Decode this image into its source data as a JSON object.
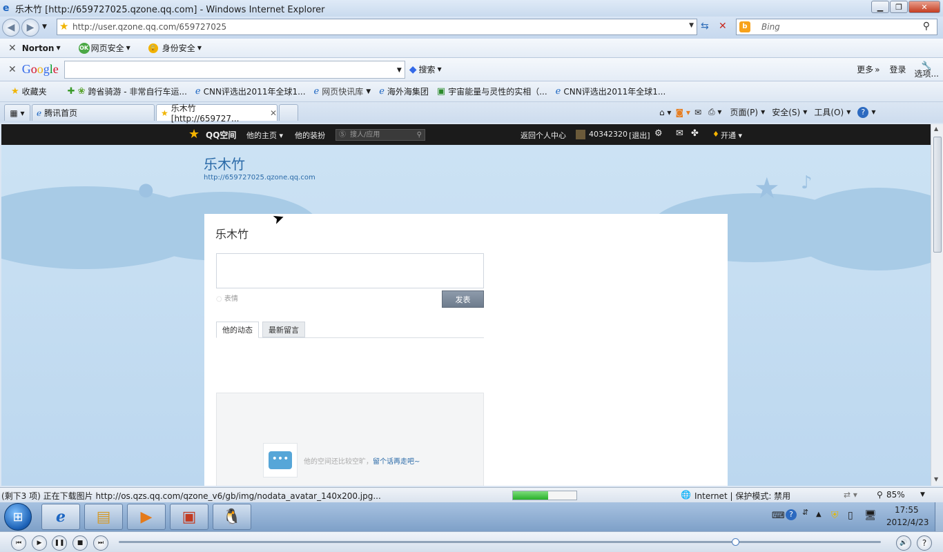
{
  "window": {
    "title": "乐木竹 [http://659727025.qzone.qq.com] - Windows Internet Explorer"
  },
  "address": {
    "url": "http://user.qzone.qq.com/659727025",
    "search_placeholder": "Bing"
  },
  "norton_bar": {
    "norton": "Norton",
    "web_security": "网页安全",
    "identity": "身份安全",
    "ok": "OK"
  },
  "google_bar": {
    "logo": "Google",
    "search_label": "搜索",
    "more": "更多",
    "login": "登录",
    "options": "选项..."
  },
  "favorites": {
    "label": "收藏夹",
    "items": [
      "跨省骑游 - 非常自行车运...",
      "CNN评选出2011年全球1...",
      "网页快讯库",
      "海外海集团",
      "宇宙能量与灵性的实相（...",
      "CNN评选出2011年全球1..."
    ]
  },
  "tabs": {
    "items": [
      "腾讯首页",
      "乐木竹 [http://659727..."
    ]
  },
  "commands": {
    "page": "页面(P)",
    "safety": "安全(S)",
    "tools": "工具(O)"
  },
  "qqbar": {
    "logo": "QQ空间",
    "home": "他的主页",
    "dress": "他的装扮",
    "search_placeholder": "搜人/应用",
    "back": "返回个人中心",
    "qq_number": "40342320",
    "logout": "[退出]",
    "open": "开通"
  },
  "profile": {
    "name": "乐木竹",
    "url": "http://659727025.qzone.qq.com",
    "card_name": "乐木竹"
  },
  "post": {
    "emoji": "表情",
    "submit": "发表"
  },
  "feed_tabs": {
    "activity": "他的动态",
    "messages": "最新留言"
  },
  "empty": {
    "text": "他的空间还比较空旷，",
    "link": "留个话再走吧~"
  },
  "status": {
    "message": "(剩下3 项) 正在下载图片 http://os.qzs.qq.com/qzone_v6/gb/img/nodata_avatar_140x200.jpg...",
    "progress": 0.55,
    "zone": "Internet | 保护模式: 禁用",
    "zoom": "85%"
  },
  "clock": {
    "time": "17:55",
    "date": "2012/4/23"
  },
  "colors": {
    "qqbar": "#1b1b1b",
    "sky": "#c6ddf1",
    "link": "#2a6aa8",
    "progress": "#28b02a"
  }
}
